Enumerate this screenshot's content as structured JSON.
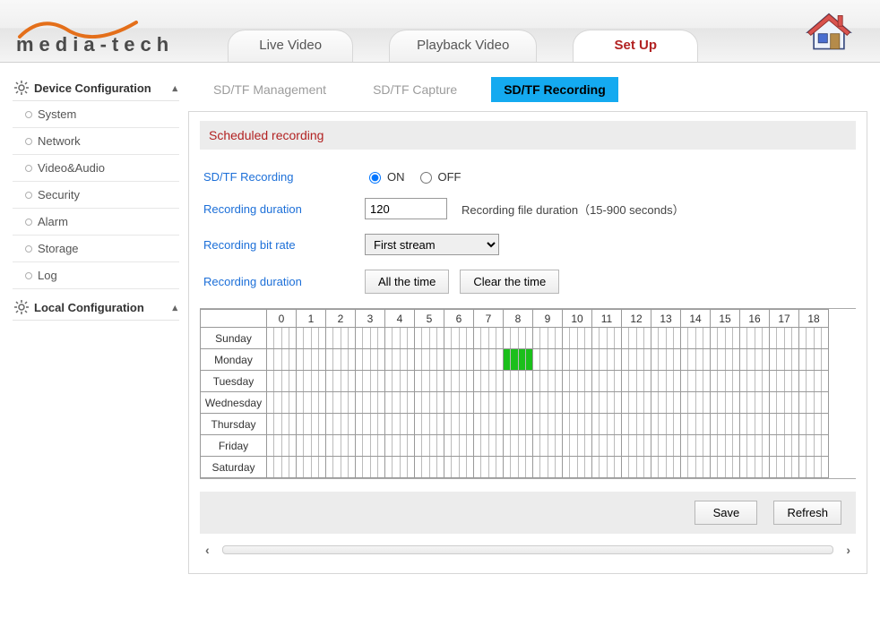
{
  "logo": {
    "text": "media-tech"
  },
  "main_tabs": [
    {
      "label": "Live Video",
      "active": false
    },
    {
      "label": "Playback Video",
      "active": false
    },
    {
      "label": "Set Up",
      "active": true
    }
  ],
  "sidebar": {
    "groups": [
      {
        "title": "Device Configuration",
        "expanded": true,
        "items": [
          "System",
          "Network",
          "Video&Audio",
          "Security",
          "Alarm",
          "Storage",
          "Log"
        ]
      },
      {
        "title": "Local Configuration",
        "expanded": true,
        "items": []
      }
    ]
  },
  "subtabs": [
    {
      "label": "SD/TF Management",
      "active": false
    },
    {
      "label": "SD/TF Capture",
      "active": false
    },
    {
      "label": "SD/TF Recording",
      "active": true
    }
  ],
  "section_title": "Scheduled recording",
  "form": {
    "recording_label": "SD/TF Recording",
    "recording_on_label": "ON",
    "recording_off_label": "OFF",
    "recording_value": "ON",
    "duration_label": "Recording duration",
    "duration_value": "120",
    "duration_hint": "Recording file duration（15-900 seconds）",
    "bitrate_label": "Recording bit rate",
    "bitrate_value": "First stream",
    "schedule_label": "Recording duration",
    "btn_all_time": "All the time",
    "btn_clear_time": "Clear the time"
  },
  "schedule": {
    "hours": [
      "0",
      "1",
      "2",
      "3",
      "4",
      "5",
      "6",
      "7",
      "8",
      "9",
      "10",
      "11",
      "12",
      "13",
      "14",
      "15",
      "16",
      "17",
      "18"
    ],
    "days": [
      "Sunday",
      "Monday",
      "Tuesday",
      "Wednesday",
      "Thursday",
      "Friday",
      "Saturday"
    ],
    "selection": {
      "day": "Monday",
      "hour_start": 8,
      "hour_end": 9,
      "quarters_filled": [
        0,
        1,
        2,
        3
      ]
    }
  },
  "actions": {
    "save": "Save",
    "refresh": "Refresh"
  }
}
